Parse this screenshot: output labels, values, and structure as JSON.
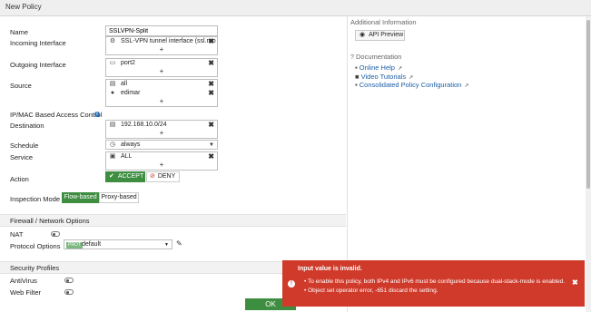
{
  "window": {
    "title": "New Policy"
  },
  "form": {
    "name": {
      "label": "Name",
      "value": "SSLVPN-Split"
    },
    "incoming": {
      "label": "Incoming Interface",
      "items": [
        "SSL-VPN tunnel interface (ssl.roo"
      ]
    },
    "outgoing": {
      "label": "Outgoing Interface",
      "items": [
        "port2"
      ]
    },
    "source": {
      "label": "Source",
      "items": [
        "all",
        "edimar"
      ]
    },
    "ipmac": {
      "label": "IP/MAC Based Access Control"
    },
    "destination": {
      "label": "Destination",
      "items": [
        "192.168.10.0/24"
      ]
    },
    "schedule": {
      "label": "Schedule",
      "value": "always"
    },
    "service": {
      "label": "Service",
      "items": [
        "ALL"
      ]
    },
    "action": {
      "label": "Action",
      "accept": "ACCEPT",
      "deny": "DENY"
    },
    "inspection": {
      "label": "Inspection Mode",
      "flow": "Flow-based",
      "proxy": "Proxy-based"
    }
  },
  "firewall": {
    "title": "Firewall / Network Options",
    "nat_label": "NAT",
    "protocol_label": "Protocol Options",
    "prot_badge": "PROT",
    "protocol_value": "default"
  },
  "security": {
    "title": "Security Profiles",
    "antivirus": "AntiVirus",
    "webfilter": "Web Filter"
  },
  "buttons": {
    "ok": "OK"
  },
  "sidebar": {
    "additional_title": "Additional Information",
    "api_preview": "API Preview",
    "documentation_title": "Documentation",
    "links": [
      "Online Help",
      "Video Tutorials",
      "Consolidated Policy Configuration"
    ]
  },
  "error": {
    "title": "Input value is invalid.",
    "messages": [
      "To enable this policy, both IPv4 and IPv6 must be configured because dual-stack-mode is enabled.",
      "Object set operator error, -651 discard the setting."
    ]
  },
  "colors": {
    "accept_green": "#3e8e41",
    "flow_green": "#3e8e41",
    "ok_green": "#3e8e41",
    "error_red": "#d03a2b",
    "link_blue": "#1d5ea8",
    "info_blue": "#2a6fb5"
  },
  "icons": {
    "incoming": "ssl-vpn-icon",
    "outgoing": "interface-port-icon",
    "source": [
      "address-icon",
      "user-icon"
    ],
    "destination": "address-icon",
    "schedule": "schedule-icon",
    "service": "service-icon",
    "api": "eye-icon",
    "documentation": "help-circle-icon",
    "links": [
      "book-icon",
      "video-icon",
      "book-icon"
    ],
    "external": "external-link-icon",
    "error": "error-icon"
  }
}
